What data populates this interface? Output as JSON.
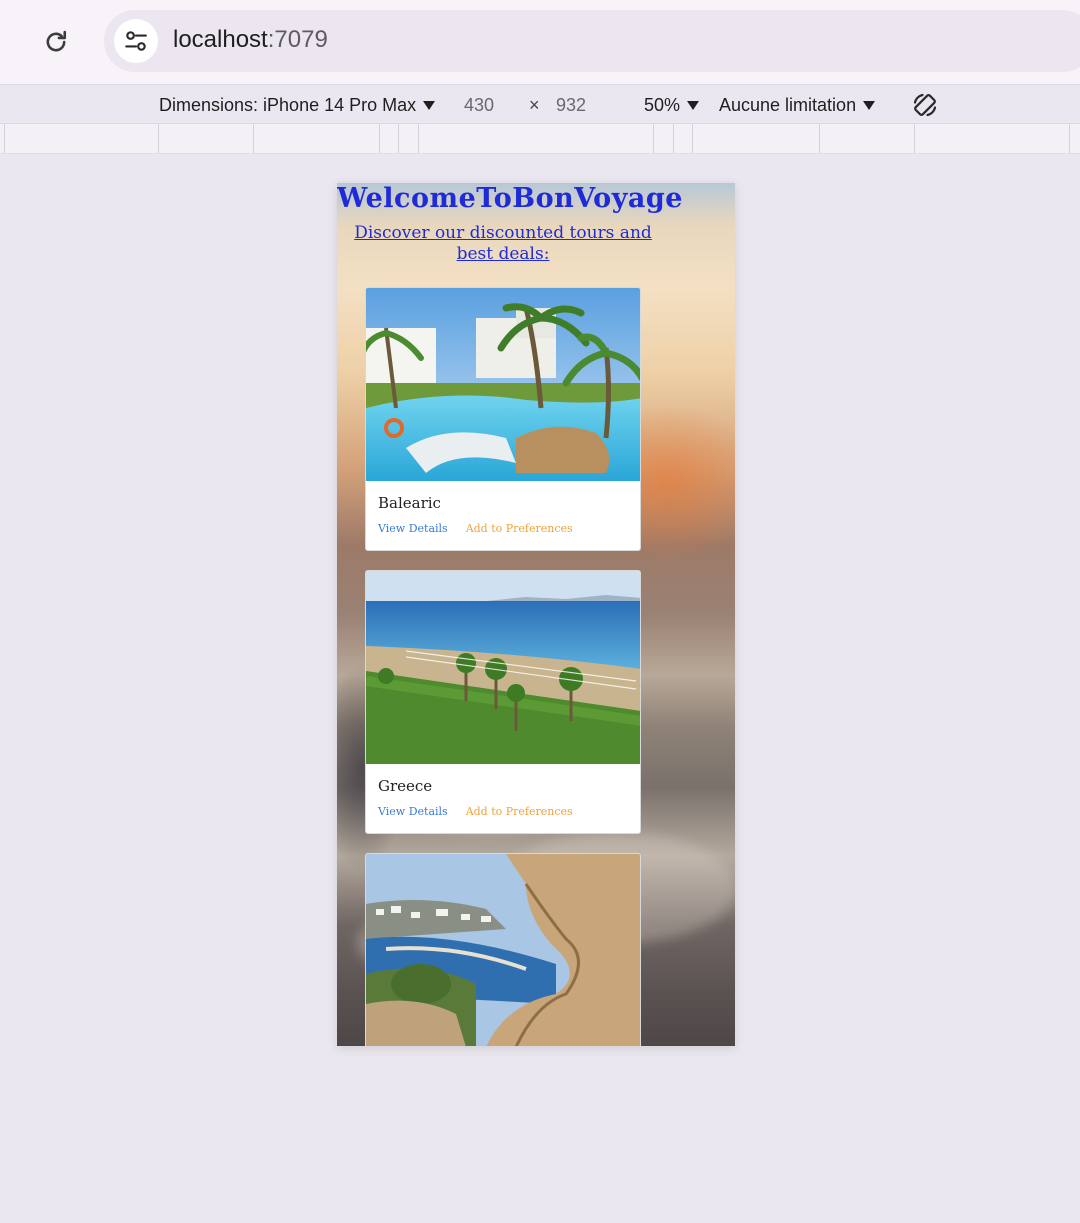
{
  "browser": {
    "url_host": "localhost",
    "url_port": ":7079",
    "reload_icon": "reload-icon",
    "site_info_icon": "tune-icon"
  },
  "device_toolbar": {
    "dimensions_label": "Dimensions: iPhone 14 Pro Max",
    "width": "430",
    "separator": "×",
    "height": "932",
    "zoom": "50%",
    "throttle": "Aucune limitation",
    "rotate_icon": "rotate-icon"
  },
  "page": {
    "title": "WelcomeToBonVoyage",
    "subtitle": "Discover our discounted tours and best deals:",
    "cards": [
      {
        "name": "Balearic",
        "details": "View Details",
        "prefs": "Add to Preferences"
      },
      {
        "name": "Greece",
        "details": "View Details",
        "prefs": "Add to Preferences"
      }
    ]
  },
  "colors": {
    "heading": "#1f2bd6",
    "details_link": "#3a7bd5",
    "prefs_link": "#f0a23a"
  }
}
